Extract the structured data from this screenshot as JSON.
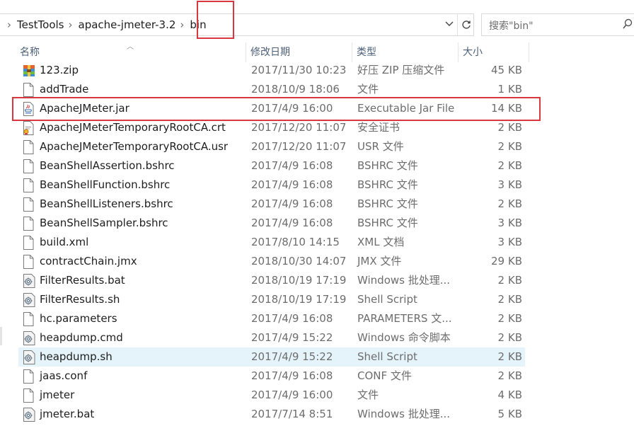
{
  "breadcrumbs": [
    "TestTools",
    "apache-jmeter-3.2",
    "bin"
  ],
  "search": {
    "placeholder": "搜索\"bin\""
  },
  "columns": {
    "name": "名称",
    "date": "修改日期",
    "type": "类型",
    "size": "大小"
  },
  "files": [
    {
      "name": "123.zip",
      "date": "2017/11/30 10:23",
      "type": "好压 ZIP 压缩文件",
      "size": "45 KB",
      "icon": "zip-archive-icon"
    },
    {
      "name": "addTrade",
      "date": "2018/10/9 18:06",
      "type": "文件",
      "size": "1 KB",
      "icon": "file-icon"
    },
    {
      "name": "ApacheJMeter.jar",
      "date": "2017/4/9 16:00",
      "type": "Executable Jar File",
      "size": "14 KB",
      "icon": "java-jar-icon"
    },
    {
      "name": "ApacheJMeterTemporaryRootCA.crt",
      "date": "2017/12/20 11:07",
      "type": "安全证书",
      "size": "2 KB",
      "icon": "certificate-icon"
    },
    {
      "name": "ApacheJMeterTemporaryRootCA.usr",
      "date": "2017/12/20 11:07",
      "type": "USR 文件",
      "size": "2 KB",
      "icon": "file-icon"
    },
    {
      "name": "BeanShellAssertion.bshrc",
      "date": "2017/4/9 16:08",
      "type": "BSHRC 文件",
      "size": "2 KB",
      "icon": "file-icon"
    },
    {
      "name": "BeanShellFunction.bshrc",
      "date": "2017/4/9 16:08",
      "type": "BSHRC 文件",
      "size": "3 KB",
      "icon": "file-icon"
    },
    {
      "name": "BeanShellListeners.bshrc",
      "date": "2017/4/9 16:08",
      "type": "BSHRC 文件",
      "size": "2 KB",
      "icon": "file-icon"
    },
    {
      "name": "BeanShellSampler.bshrc",
      "date": "2017/4/9 16:08",
      "type": "BSHRC 文件",
      "size": "3 KB",
      "icon": "file-icon"
    },
    {
      "name": "build.xml",
      "date": "2017/8/10 14:15",
      "type": "XML 文档",
      "size": "3 KB",
      "icon": "file-icon"
    },
    {
      "name": "contractChain.jmx",
      "date": "2018/10/30 14:07",
      "type": "JMX 文件",
      "size": "29 KB",
      "icon": "file-icon"
    },
    {
      "name": "FilterResults.bat",
      "date": "2018/10/19 17:19",
      "type": "Windows 批处理...",
      "size": "2 KB",
      "icon": "script-gear-icon"
    },
    {
      "name": "FilterResults.sh",
      "date": "2018/10/19 17:19",
      "type": "Shell Script",
      "size": "2 KB",
      "icon": "script-gear-icon"
    },
    {
      "name": "hc.parameters",
      "date": "2017/4/9 16:08",
      "type": "PARAMETERS 文...",
      "size": "2 KB",
      "icon": "file-icon"
    },
    {
      "name": "heapdump.cmd",
      "date": "2017/4/9 15:22",
      "type": "Windows 命令脚本",
      "size": "2 KB",
      "icon": "script-gear-icon"
    },
    {
      "name": "heapdump.sh",
      "date": "2017/4/9 15:22",
      "type": "Shell Script",
      "size": "2 KB",
      "icon": "script-gear-icon",
      "selected": true
    },
    {
      "name": "jaas.conf",
      "date": "2017/4/9 16:08",
      "type": "CONF 文件",
      "size": "2 KB",
      "icon": "file-icon"
    },
    {
      "name": "jmeter",
      "date": "2017/4/9 16:00",
      "type": "文件",
      "size": "4 KB",
      "icon": "file-icon"
    },
    {
      "name": "jmeter.bat",
      "date": "2017/7/14 8:51",
      "type": "Windows 批处理...",
      "size": "5 KB",
      "icon": "script-gear-icon"
    }
  ],
  "colors": {
    "highlight_box": "#d9383c",
    "selected_row": "#e5f3fb",
    "header_text": "#4c607a"
  }
}
